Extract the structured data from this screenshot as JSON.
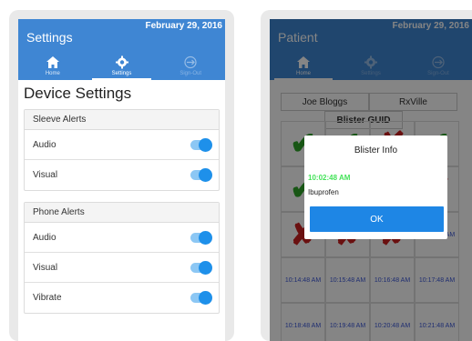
{
  "settings_screen": {
    "app_title": "Settings",
    "date": "February 29, 2016",
    "nav": [
      {
        "label": "Home",
        "icon": "home-icon"
      },
      {
        "label": "Settings",
        "icon": "gear-icon"
      },
      {
        "label": "Sign-Out",
        "icon": "sign-out-icon"
      }
    ],
    "page_title": "Device Settings",
    "sleeve_alerts": {
      "title": "Sleeve Alerts",
      "items": [
        {
          "label": "Audio",
          "on": true
        },
        {
          "label": "Visual",
          "on": true
        }
      ]
    },
    "phone_alerts": {
      "title": "Phone Alerts",
      "items": [
        {
          "label": "Audio",
          "on": true
        },
        {
          "label": "Visual",
          "on": true
        },
        {
          "label": "Vibrate",
          "on": true
        }
      ]
    }
  },
  "patient_screen": {
    "app_title": "Patient",
    "date": "February 29, 2016",
    "nav": [
      {
        "label": "Home",
        "icon": "home-icon"
      },
      {
        "label": "Settings",
        "icon": "gear-icon"
      },
      {
        "label": "Sign-Out",
        "icon": "sign-out-icon"
      }
    ],
    "patient_name": "Joe Bloggs",
    "pharmacy": "RxVille",
    "grid_header": "Blister GUID",
    "cells": {
      "r2c3": "10:13:48 AM",
      "r3c0": "10:14:48 AM",
      "r3c1": "10:15:48 AM",
      "r3c2": "10:16:48 AM",
      "r3c3": "10:17:48 AM",
      "r4c0": "10:18:48 AM",
      "r4c1": "10:19:48 AM",
      "r4c2": "10:20:48 AM",
      "r4c3": "10:21:48 AM"
    },
    "dialog": {
      "title": "Blister Info",
      "time": "10:02:48 AM",
      "medication": "Ibuprofen",
      "ok_label": "OK"
    }
  },
  "colors": {
    "header_blue": "#3f86d3",
    "toggle_blue": "#1e90ea",
    "check_green": "#2ea52a",
    "cross_red": "#cc1f1f",
    "time_green": "#45e35a"
  }
}
